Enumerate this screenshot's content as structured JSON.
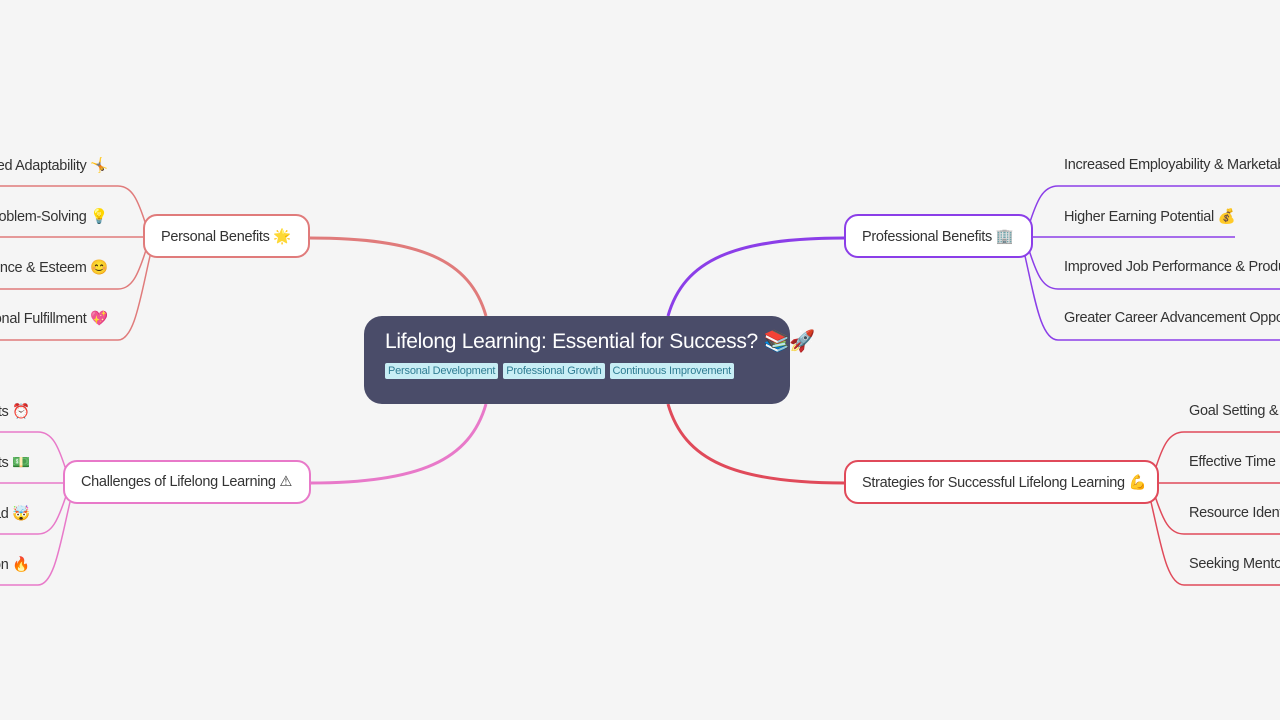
{
  "root": {
    "title": "Lifelong Learning: Essential for Success? 📚🚀",
    "tags": [
      "Personal Development",
      "Professional Growth",
      "Continuous Improvement"
    ]
  },
  "colors": {
    "background": "#f5f5f5",
    "root_bg": "#4a4c69",
    "personal": "#e07b7b",
    "challenges": "#e879c9",
    "professional": "#8b3ee8",
    "strategies": "#e04a5a"
  },
  "branches": {
    "personal": {
      "label": "Personal Benefits 🌟",
      "children": [
        "ed Adaptability 🤸",
        "roblem-Solving 💡",
        "dence & Esteem 😊",
        "onal Fulfillment 💖"
      ]
    },
    "challenges": {
      "label": "Challenges of Lifelong Learning ⚠",
      "children": [
        "ts ⏰",
        "ts 💵",
        "ad 🤯",
        "on 🔥"
      ]
    },
    "professional": {
      "label": "Professional Benefits 🏢",
      "children": [
        "Increased Employability & Marketabi",
        "Higher Earning Potential 💰",
        "Improved Job Performance & Produc",
        "Greater Career Advancement Opport"
      ]
    },
    "strategies": {
      "label": "Strategies for Successful Lifelong Learning 💪",
      "children": [
        "Goal Setting & P",
        "Effective Time M",
        "Resource Identi",
        "Seeking Mentor"
      ]
    }
  }
}
